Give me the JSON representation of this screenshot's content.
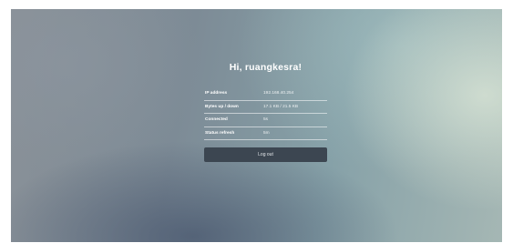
{
  "greeting": "Hi, ruangkesra!",
  "status_rows": [
    {
      "label": "IP address",
      "value": "192.168.40.254"
    },
    {
      "label": "Bytes up / down",
      "value": "17.1 KB / 21.5 KB"
    },
    {
      "label": "Connected",
      "value": "5s"
    },
    {
      "label": "Status refresh",
      "value": "5m"
    }
  ],
  "logout_label": "Log out"
}
